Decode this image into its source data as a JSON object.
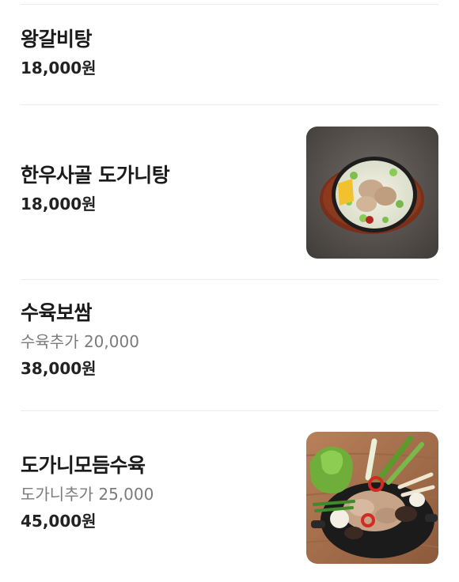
{
  "menu": {
    "items": [
      {
        "name": "왕갈비탕",
        "price": "18,000원"
      },
      {
        "name": "한우사골 도가니탕",
        "price": "18,000원",
        "image": "dogani-tang-photo"
      },
      {
        "name": "수육보쌈",
        "description": "수육추가 20,000",
        "price": "38,000원"
      },
      {
        "name": "도가니모듬수육",
        "description": "도가니추가 25,000",
        "price": "45,000원",
        "image": "dogani-suyuk-photo"
      }
    ]
  }
}
